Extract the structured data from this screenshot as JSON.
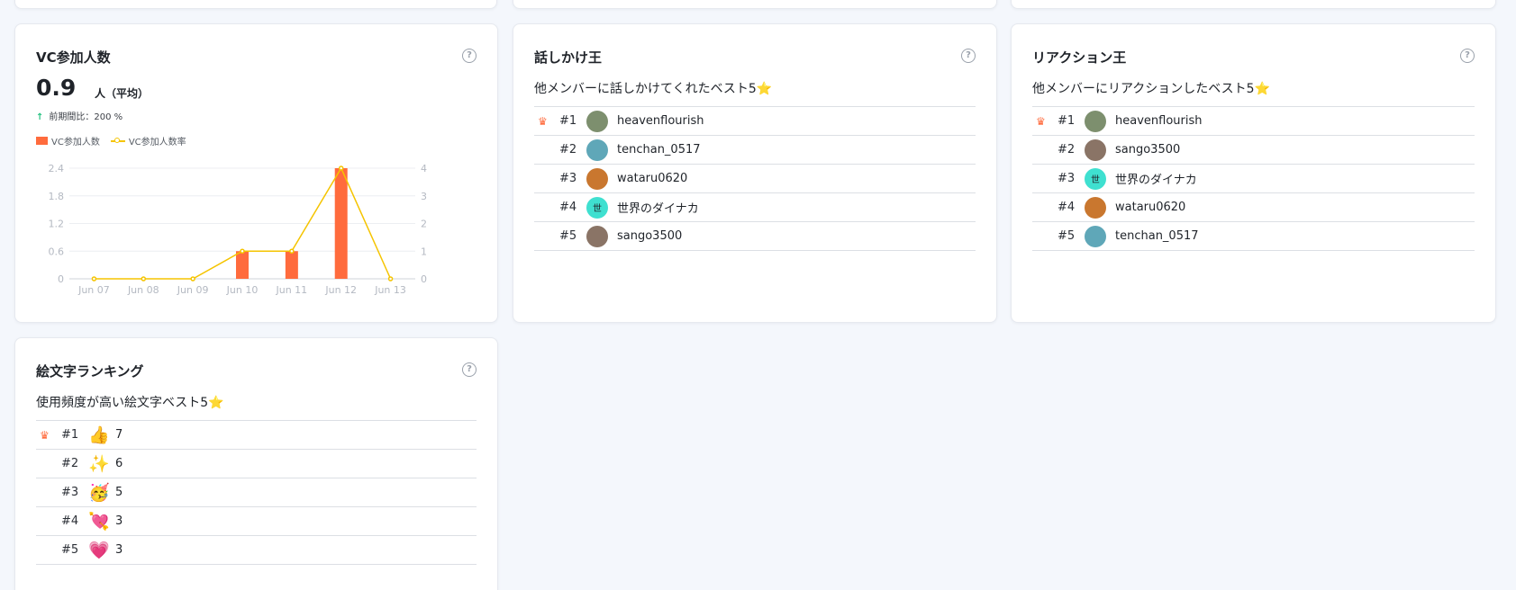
{
  "colors": {
    "bar": "#ff6b3d",
    "line": "#f5c400",
    "accent": "#ff6b3d"
  },
  "vc": {
    "title": "VC参加人数",
    "help": "?",
    "value": "0.9",
    "unit": "人（平均）",
    "comparison_arrow": "↑",
    "comparison": "前期間比：200 %",
    "legend_bar": "VC参加人数",
    "legend_line": "VC参加人数率"
  },
  "chart_data": {
    "type": "bar",
    "categories": [
      "Jun 07",
      "Jun 08",
      "Jun 09",
      "Jun 10",
      "Jun 11",
      "Jun 12",
      "Jun 13"
    ],
    "series": [
      {
        "name": "VC参加人数",
        "type": "bar",
        "axis": "left",
        "values": [
          0,
          0,
          0,
          0.6,
          0.6,
          2.4,
          0
        ]
      },
      {
        "name": "VC参加人数率",
        "type": "line",
        "axis": "right",
        "values": [
          0,
          0,
          0,
          1,
          1,
          4,
          0
        ]
      }
    ],
    "ylim": [
      0,
      2.4
    ],
    "yticks": [
      "0",
      "0.6",
      "1.2",
      "1.8",
      "2.4"
    ],
    "y2lim": [
      0,
      4
    ],
    "y2ticks": [
      "0",
      "1",
      "2",
      "3",
      "4"
    ],
    "grid": true,
    "legend": "top-left"
  },
  "talk": {
    "title": "話しかけ王",
    "help": "?",
    "subtitle": "他メンバーに話しかけてくれたベスト5",
    "crown": "♛",
    "rows": [
      {
        "rank": "#1",
        "name": "heavenflourish",
        "avatar_color": "#7d8f6e",
        "avatar_text": ""
      },
      {
        "rank": "#2",
        "name": "tenchan_0517",
        "avatar_color": "#5fa7b8",
        "avatar_text": ""
      },
      {
        "rank": "#3",
        "name": "wataru0620",
        "avatar_color": "#c9772f",
        "avatar_text": ""
      },
      {
        "rank": "#4",
        "name": "世界のダイナカ",
        "avatar_color": "#3fe0d0",
        "avatar_text": "世"
      },
      {
        "rank": "#5",
        "name": "sango3500",
        "avatar_color": "#8a7466",
        "avatar_text": ""
      }
    ]
  },
  "reaction": {
    "title": "リアクション王",
    "help": "?",
    "subtitle": "他メンバーにリアクションしたベスト5",
    "crown": "♛",
    "rows": [
      {
        "rank": "#1",
        "name": "heavenflourish",
        "avatar_color": "#7d8f6e",
        "avatar_text": ""
      },
      {
        "rank": "#2",
        "name": "sango3500",
        "avatar_color": "#8a7466",
        "avatar_text": ""
      },
      {
        "rank": "#3",
        "name": "世界のダイナカ",
        "avatar_color": "#3fe0d0",
        "avatar_text": "世"
      },
      {
        "rank": "#4",
        "name": "wataru0620",
        "avatar_color": "#c9772f",
        "avatar_text": ""
      },
      {
        "rank": "#5",
        "name": "tenchan_0517",
        "avatar_color": "#5fa7b8",
        "avatar_text": ""
      }
    ]
  },
  "emoji": {
    "title": "絵文字ランキング",
    "help": "?",
    "subtitle": "使用頻度が高い絵文字ベスト5",
    "crown": "♛",
    "rows": [
      {
        "rank": "#1",
        "emoji": "👍",
        "count": "7"
      },
      {
        "rank": "#2",
        "emoji": "✨",
        "count": "6"
      },
      {
        "rank": "#3",
        "emoji": "🥳",
        "count": "5"
      },
      {
        "rank": "#4",
        "emoji": "💘",
        "count": "3"
      },
      {
        "rank": "#5",
        "emoji": "💗",
        "count": "3"
      }
    ]
  },
  "star": "⭐"
}
